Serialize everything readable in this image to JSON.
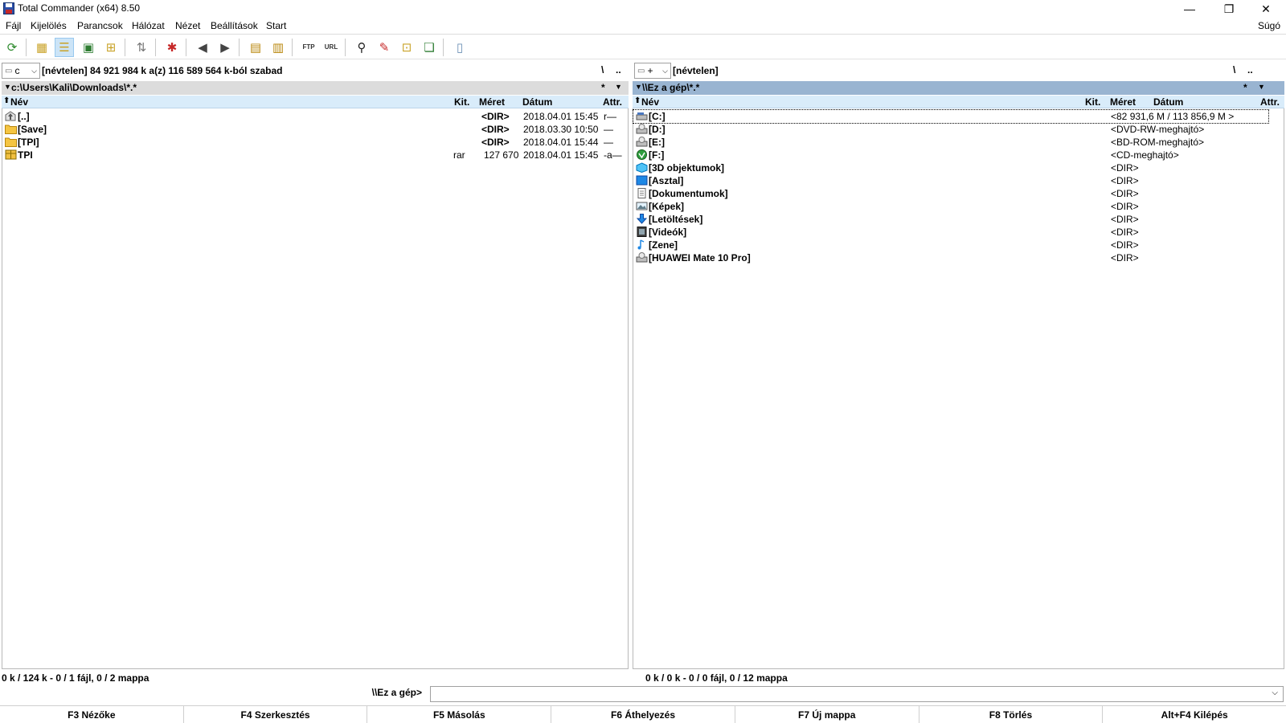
{
  "window": {
    "title": "Total Commander (x64) 8.50",
    "minimize": "—",
    "restore": "❐",
    "close": "✕"
  },
  "menu": {
    "items": [
      "Fájl",
      "Kijelölés",
      "Parancsok",
      "Hálózat",
      "Nézet",
      "Beállítások",
      "Start"
    ],
    "help": "Súgó"
  },
  "left": {
    "drive": "c",
    "volume_info": "[névtelen]  84 921 984 k a(z) 116 589 564 k-ból szabad",
    "root_btn": "\\",
    "up_btn": "..",
    "path": "c:\\Users\\Kali\\Downloads\\*.*",
    "filter_btn": "*",
    "headers": {
      "name": "Név",
      "ext": "Kit.",
      "size": "Méret",
      "date": "Dátum",
      "attr": "Attr."
    },
    "rows": [
      {
        "icon": "up-dir-icon",
        "name": "[..]",
        "ext": "",
        "size": "<DIR>",
        "date": "2018.04.01 15:45",
        "attr": "r—"
      },
      {
        "icon": "folder-icon",
        "name": "[Save]",
        "ext": "",
        "size": "<DIR>",
        "date": "2018.03.30 10:50",
        "attr": "—"
      },
      {
        "icon": "folder-icon",
        "name": "[TPI]",
        "ext": "",
        "size": "<DIR>",
        "date": "2018.04.01 15:44",
        "attr": "—"
      },
      {
        "icon": "archive-icon",
        "name": "TPI",
        "ext": "rar",
        "size": "127 670",
        "date": "2018.04.01 15:45",
        "attr": "-a—"
      }
    ],
    "status": "0 k / 124 k - 0 / 1 fájl, 0 / 2 mappa"
  },
  "right": {
    "drive": "+",
    "volume_info": "[névtelen]",
    "root_btn": "\\",
    "up_btn": "..",
    "path": "\\\\Ez a gép\\*.*",
    "filter_btn": "*",
    "headers": {
      "name": "Név",
      "ext": "Kit.",
      "size": "Méret",
      "date": "Dátum",
      "attr": "Attr."
    },
    "rows": [
      {
        "icon": "hard-drive-icon",
        "name": "[C:]",
        "size": "<82 931,6 M / 113 856,9 M >"
      },
      {
        "icon": "optical-drive-icon",
        "name": "[D:]",
        "size": "<DVD-RW-meghajtó>"
      },
      {
        "icon": "optical-drive-icon",
        "name": "[E:]",
        "size": "<BD-ROM-meghajtó>"
      },
      {
        "icon": "cd-drive-icon",
        "name": "[F:]",
        "size": "<CD-meghajtó>"
      },
      {
        "icon": "3d-objects-icon",
        "name": "[3D objektumok]",
        "size": "<DIR>"
      },
      {
        "icon": "desktop-icon",
        "name": "[Asztal]",
        "size": "<DIR>"
      },
      {
        "icon": "documents-icon",
        "name": "[Dokumentumok]",
        "size": "<DIR>"
      },
      {
        "icon": "pictures-icon",
        "name": "[Képek]",
        "size": "<DIR>"
      },
      {
        "icon": "downloads-icon",
        "name": "[Letöltések]",
        "size": "<DIR>"
      },
      {
        "icon": "videos-icon",
        "name": "[Videók]",
        "size": "<DIR>"
      },
      {
        "icon": "music-icon",
        "name": "[Zene]",
        "size": "<DIR>"
      },
      {
        "icon": "phone-icon",
        "name": "[HUAWEI Mate 10 Pro]",
        "size": "<DIR>"
      }
    ],
    "status": "0 k / 0 k - 0 / 0 fájl, 0 / 12 mappa"
  },
  "command": {
    "label": "\\\\Ez a gép>",
    "value": "",
    "dropdown": "⌵"
  },
  "fkeys": [
    "F3 Nézőke",
    "F4 Szerkesztés",
    "F5 Másolás",
    "F6 Áthelyezés",
    "F7 Új mappa",
    "F8 Törlés",
    "Alt+F4 Kilépés"
  ],
  "colors": {
    "active_path": "#99b4d1",
    "header": "#d9ecfa",
    "folder": "#f5c542"
  }
}
